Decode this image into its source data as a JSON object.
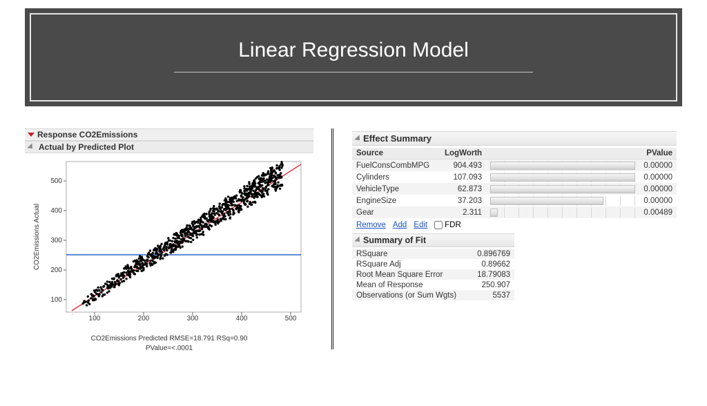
{
  "title": "Linear Regression Model",
  "left": {
    "response_header": "Response CO2Emissions",
    "plot_header": "Actual by Predicted Plot",
    "ylabel": "CO2Emissions Actual",
    "caption1": "CO2Emissions Predicted RMSE=18.791 RSq=0.90",
    "caption2": "PValue=<.0001",
    "yticks": [
      "100",
      "200",
      "300",
      "400",
      "500"
    ],
    "xticks": [
      "100",
      "200",
      "300",
      "400",
      "500"
    ]
  },
  "chart_data": {
    "type": "scatter",
    "title": "Actual by Predicted Plot",
    "xlabel": "CO2Emissions Predicted RMSE=18.791 RSq=0.90  PValue=<.0001",
    "ylabel": "CO2Emissions Actual",
    "xlim": [
      50,
      560
    ],
    "ylim": [
      50,
      560
    ],
    "identity_line": {
      "x": [
        50,
        560
      ],
      "y": [
        50,
        560
      ],
      "color": "#d72b3f"
    },
    "hline": {
      "y": 255,
      "color": "#2c63c3"
    },
    "note": "Dense scatter of ~5500 points close to identity line from (80,100) to (520,520); slight curvature below line for low predicted values; spread widens above 300."
  },
  "effect": {
    "header": "Effect Summary",
    "cols": {
      "source": "Source",
      "logworth": "LogWorth",
      "pvalue": "PValue"
    },
    "rows": [
      {
        "source": "FuelConsCombMPG",
        "logworth": "904.493",
        "barpct": 100,
        "pvalue": "0.00000"
      },
      {
        "source": "Cylinders",
        "logworth": "107.093",
        "barpct": 100,
        "pvalue": "0.00000"
      },
      {
        "source": "VehicleType",
        "logworth": "62.873",
        "barpct": 100,
        "pvalue": "0.00000"
      },
      {
        "source": "EngineSize",
        "logworth": "37.203",
        "barpct": 78,
        "pvalue": "0.00000"
      },
      {
        "source": "Gear",
        "logworth": "2.311",
        "barpct": 5,
        "pvalue": "0.00489"
      }
    ],
    "links": {
      "remove": "Remove",
      "add": "Add",
      "edit": "Edit",
      "fdr": "FDR"
    }
  },
  "fit": {
    "header": "Summary of Fit",
    "rows": [
      {
        "label": "RSquare",
        "value": "0.896769"
      },
      {
        "label": "RSquare Adj",
        "value": "0.89662"
      },
      {
        "label": "Root Mean Square Error",
        "value": "18.79083"
      },
      {
        "label": "Mean of Response",
        "value": "250.907"
      },
      {
        "label": "Observations (or Sum Wgts)",
        "value": "5537"
      }
    ]
  }
}
